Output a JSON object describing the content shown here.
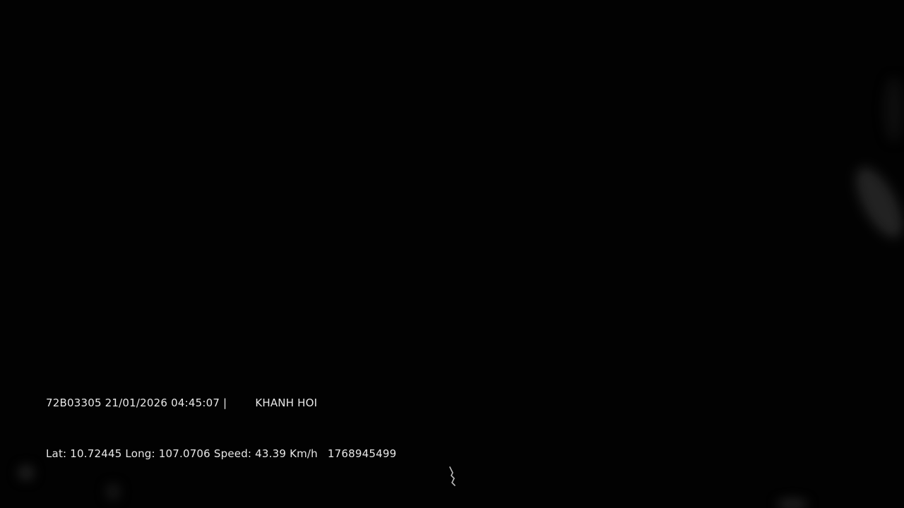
{
  "overlay": {
    "plate": "72B03305",
    "date": "21/01/2026",
    "time": "04:45:07",
    "separator": "|",
    "location": "KHANH HOI",
    "lat_label": "Lat:",
    "lat_value": "10.72445",
    "long_label": "Long:",
    "long_value": "107.0706",
    "speed_label": "Speed:",
    "speed_value": "43.39",
    "speed_unit": "Km/h",
    "timestamp": "1768945499"
  },
  "colors": {
    "background": "#020202",
    "overlay_text": "#e8e8e8"
  }
}
